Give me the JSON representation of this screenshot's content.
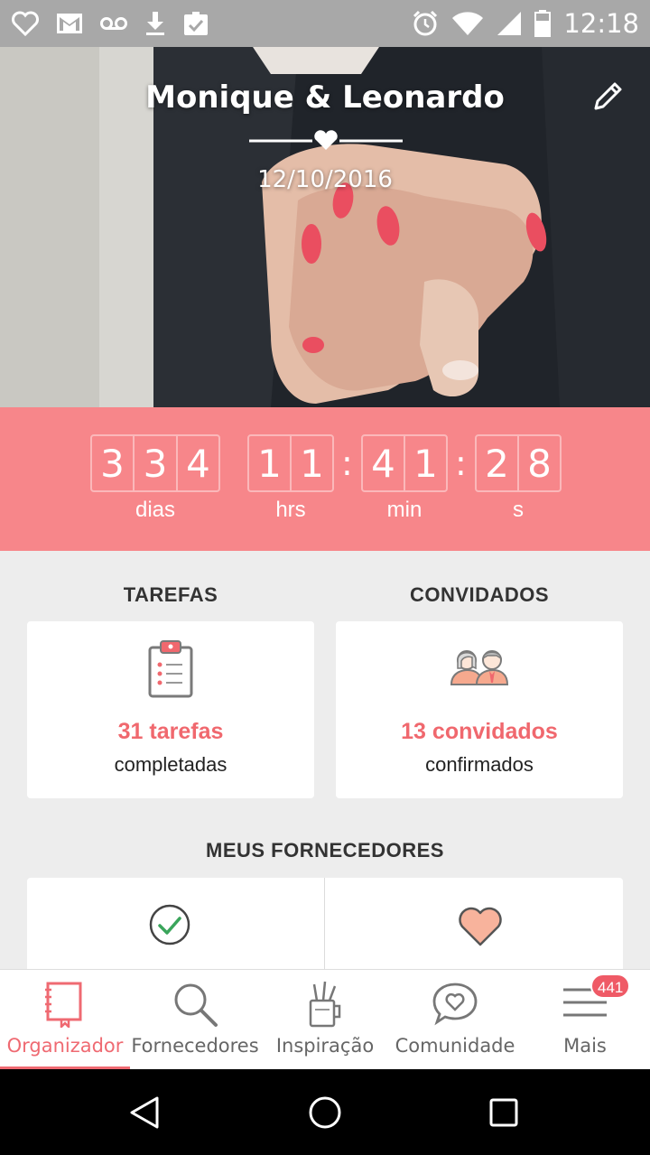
{
  "status_bar": {
    "time": "12:18",
    "left_icons": [
      "heart-outline-icon",
      "gmail-icon",
      "voicemail-icon",
      "download-icon",
      "clipboard-check-icon"
    ],
    "right_icons": [
      "alarm-icon",
      "wifi-icon",
      "signal-icon",
      "battery-icon"
    ]
  },
  "header": {
    "couple_names": "Monique & Leonardo",
    "wedding_date": "12/10/2016",
    "edit_icon": "pencil-icon"
  },
  "countdown": {
    "days": [
      "3",
      "3",
      "4"
    ],
    "hours": [
      "1",
      "1"
    ],
    "minutes": [
      "4",
      "1"
    ],
    "seconds": [
      "2",
      "8"
    ],
    "separator": ":",
    "labels": {
      "days": "dias",
      "hours": "hrs",
      "minutes": "min",
      "seconds": "s"
    }
  },
  "tasks": {
    "title": "TAREFAS",
    "count_text": "31 tarefas",
    "subtitle": "completadas",
    "icon": "clipboard-list-icon"
  },
  "guests": {
    "title": "CONVIDADOS",
    "count_text": "13 convidados",
    "subtitle": "confirmados",
    "icon": "couple-icon"
  },
  "vendors": {
    "title": "MEUS FORNECEDORES",
    "left_icon": "check-circle-icon",
    "right_icon": "heart-icon"
  },
  "tabs": [
    {
      "label": "Organizador",
      "icon": "notebook-icon",
      "active": true
    },
    {
      "label": "Fornecedores",
      "icon": "search-icon",
      "active": false
    },
    {
      "label": "Inspiração",
      "icon": "pencil-cup-icon",
      "active": false
    },
    {
      "label": "Comunidade",
      "icon": "chat-heart-icon",
      "active": false
    },
    {
      "label": "Mais",
      "icon": "menu-icon",
      "active": false,
      "badge": "441"
    }
  ],
  "colors": {
    "accent": "#f7868a",
    "accent_text": "#f0686e",
    "active_tab": "#ef6a72",
    "badge": "#ef5a66"
  }
}
